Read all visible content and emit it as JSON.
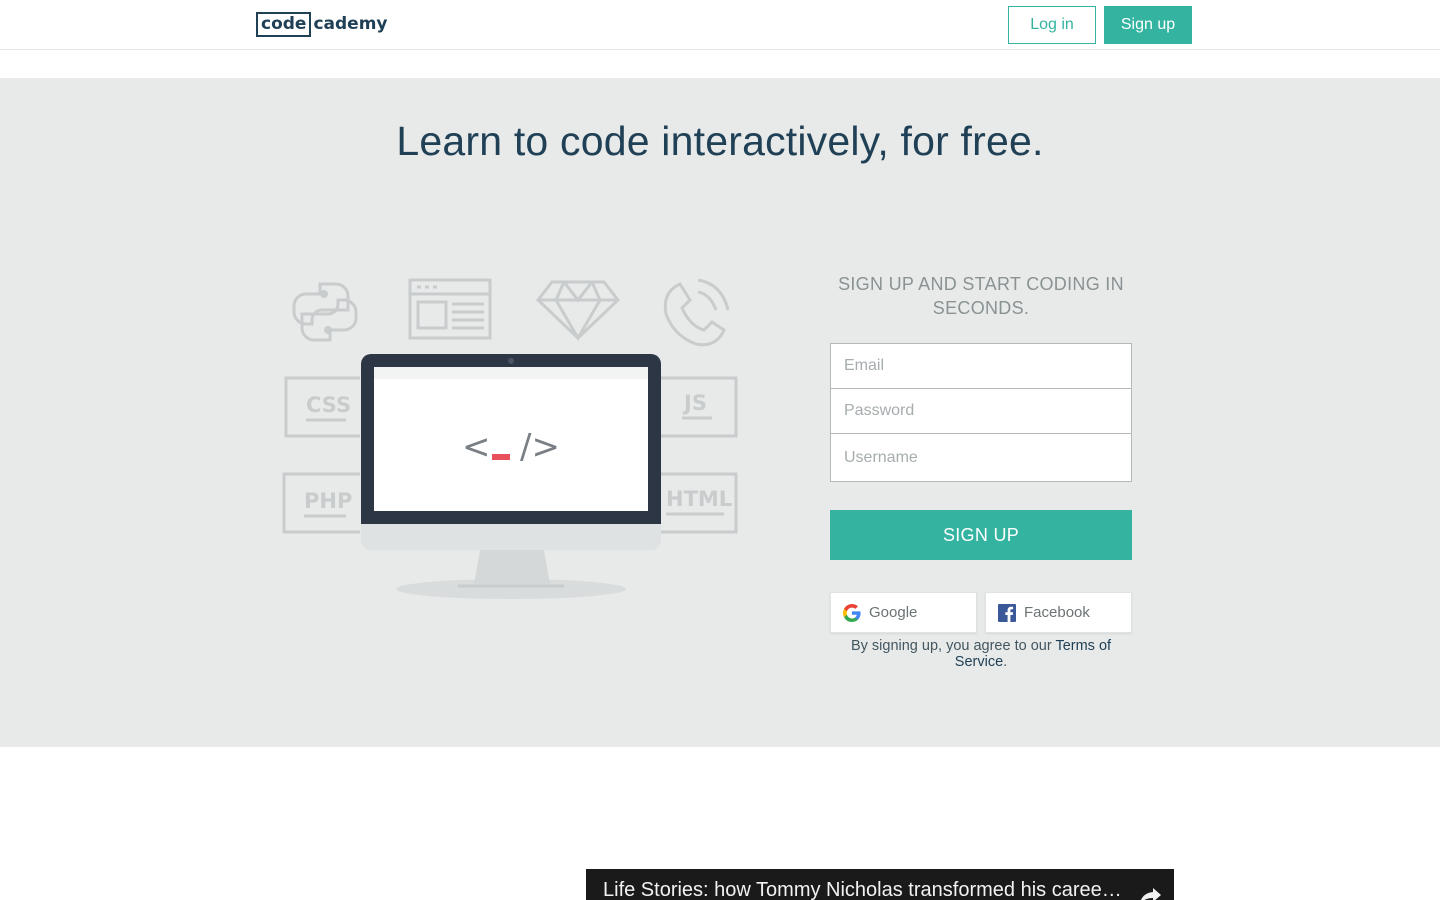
{
  "header": {
    "logo_left": "code",
    "logo_right": "cademy",
    "login_label": "Log in",
    "signup_label": "Sign up"
  },
  "hero": {
    "title": "Learn to code interactively, for free.",
    "illustration": {
      "icons": [
        "python-icon",
        "browser-icon",
        "ruby-gem-icon",
        "phone-icon",
        "css-icon",
        "js-icon",
        "php-icon",
        "html-icon",
        "monitor-icon"
      ],
      "badges": {
        "css": "CSS",
        "js": "JS",
        "php": "PHP",
        "html": "HTML"
      },
      "screen_code_left": "<",
      "screen_code_right": "/>"
    }
  },
  "signup": {
    "heading": "SIGN UP AND START CODING IN SECONDS.",
    "email_placeholder": "Email",
    "password_placeholder": "Password",
    "username_placeholder": "Username",
    "submit_label": "SIGN UP",
    "google_label": "Google",
    "facebook_label": "Facebook",
    "terms_prefix": "By signing up, you agree to our ",
    "terms_link": "Terms of Service",
    "terms_suffix": "."
  },
  "video": {
    "title": "Life Stories: how Tommy Nicholas transformed his career with…"
  },
  "colors": {
    "accent": "#34b3a0",
    "navy": "#204056",
    "hero_bg": "#e8eaea",
    "cursor_red": "#e8505b"
  }
}
